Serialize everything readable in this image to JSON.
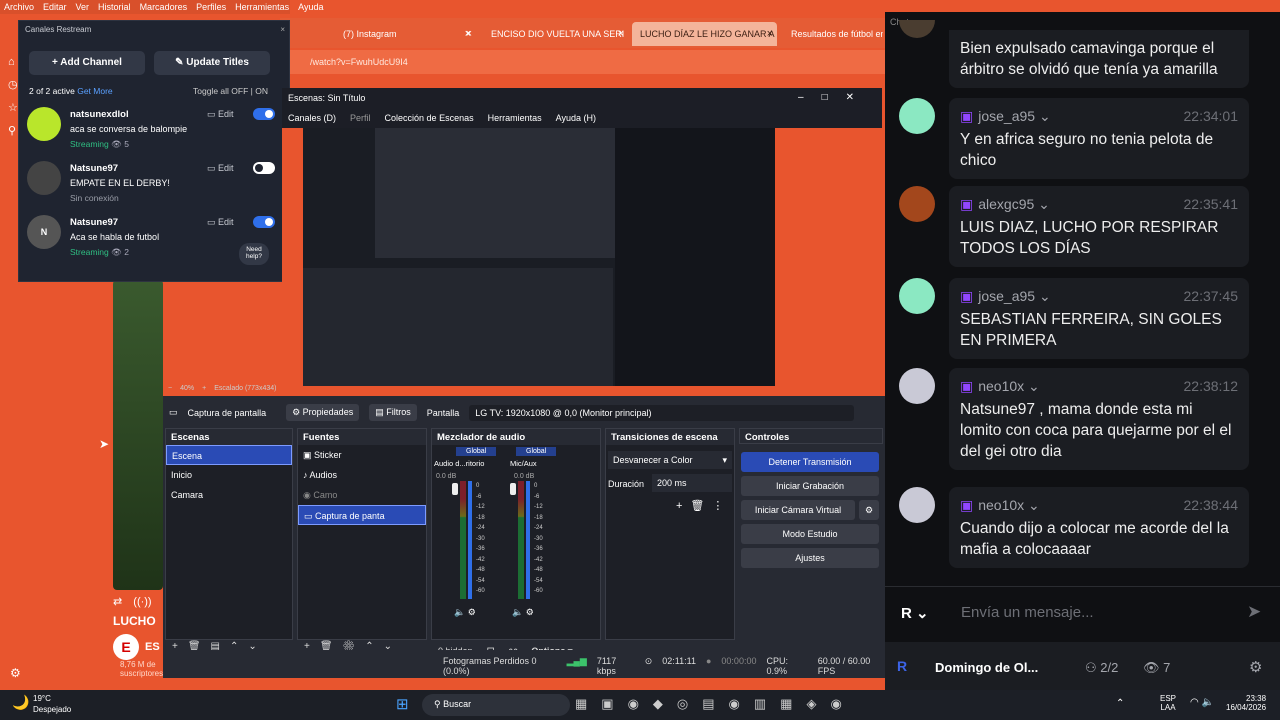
{
  "menubar": [
    "Archivo",
    "Editar",
    "Ver",
    "Historial",
    "Marcadores",
    "Perfiles",
    "Herramientas",
    "Ayuda"
  ],
  "tabs": [
    {
      "label": "(7) Instagram"
    },
    {
      "label": "ENCISO DIO VUELTA UNA SERI"
    },
    {
      "label": "LUCHO DÍAZ LE HIZO GANAR A"
    },
    {
      "label": "Resultados de fútbol en"
    }
  ],
  "url": "/watch?v=FwuhUdcU9I4",
  "restream": {
    "header": "Canales Restream",
    "add_channel": "Add Channel",
    "update_titles": "Update Titles",
    "active": "2 of 2 active",
    "get_more": "Get More",
    "toggle_all": "Toggle all",
    "off": "OFF",
    "on": "ON",
    "edit": "Edit",
    "need_help": "Need help?",
    "channels": [
      {
        "name": "natsunexdlol",
        "title": "aca se conversa de balompie",
        "status": "Streaming",
        "viewers": "5"
      },
      {
        "name": "Natsune97",
        "title": "EMPATE EN EL DERBY!",
        "status": "Sin conexión",
        "viewers": ""
      },
      {
        "name": "Natsune97",
        "title": "Aca se habla de futbol",
        "status": "Streaming",
        "viewers": "2"
      }
    ]
  },
  "obs": {
    "window_title": "Escenas: Sin Título",
    "menu": [
      "Canales (D)",
      "Perfil",
      "Colección de Escenas",
      "Herramientas",
      "Ayuda (H)"
    ],
    "zoom": "40%",
    "scaled": "Escalado (773x434)",
    "source_toolbar": {
      "name": "Captura de pantalla",
      "props": "Propiedades",
      "filters": "Filtros",
      "screen_label": "Pantalla",
      "screen_value": "LG TV: 1920x1080 @ 0,0 (Monitor principal)"
    },
    "scenes_title": "Escenas",
    "scenes": [
      "Escena",
      "Inicio",
      "Camara"
    ],
    "sources_title": "Fuentes",
    "sources": [
      "Sticker",
      "Audios",
      "Camo",
      "Captura de panta"
    ],
    "mixer_title": "Mezclador de audio",
    "mixer_global": "Global",
    "mixer_ch1": "Audio d...ritorio",
    "mixer_ch2": "Mic/Aux",
    "mixer_db": "0.0 dB",
    "mixer_scale": [
      "0",
      "-6",
      "-12",
      "-18",
      "-24",
      "-30",
      "-36",
      "-42",
      "-48",
      "-54",
      "-60"
    ],
    "hidden": "0 hidden",
    "options": "Options",
    "transitions_title": "Transiciones de escena",
    "transition": "Desvanecer a Color",
    "duration_label": "Duración",
    "duration": "200 ms",
    "controls_title": "Controles",
    "controls": [
      "Detener Transmisión",
      "Iniciar Grabación",
      "Iniciar Cámara Virtual",
      "Modo Estudio",
      "Ajustes"
    ],
    "status": {
      "dropped": "Fotogramas Perdidos 0 (0.0%)",
      "kbps": "7117 kbps",
      "stream_time": "02:11:11",
      "rec_time": "00:00:00",
      "cpu": "CPU: 0.9%",
      "fps": "60.00 / 60.00 FPS"
    }
  },
  "chat": {
    "title": "Chat",
    "top_msg": "Bien expulsado camavinga porque el árbitro se olvidó que tenía ya amarilla",
    "messages": [
      {
        "user": "jose_a95",
        "time": "22:34:01",
        "text": "Y en africa seguro no tenia pelota de chico"
      },
      {
        "user": "alexgc95",
        "time": "22:35:41",
        "text": "LUIS DIAZ, LUCHO POR RESPIRAR TODOS LOS DÍAS"
      },
      {
        "user": "jose_a95",
        "time": "22:37:45",
        "text": "SEBASTIAN FERREIRA, SIN GOLES EN PRIMERA"
      },
      {
        "user": "neo10x",
        "time": "22:38:12",
        "text": "Natsune97 , mama donde esta mi lomito con coca para quejarme por el el del gei otro dia"
      },
      {
        "user": "neo10x",
        "time": "22:38:44",
        "text": "Cuando dijo a colocar me acorde del la mafia a colocaaaar"
      }
    ],
    "placeholder": "Envía un mensaje...",
    "footer_name": "Domingo de Ol...",
    "count": "2/2",
    "viewers": "7"
  },
  "page": {
    "video_title": "LUCHO",
    "channel": "ES",
    "subs": "8,76 M de suscriptores"
  },
  "taskbar": {
    "temp": "19°C",
    "weather": "Despejado",
    "search": "Buscar",
    "lang1": "ESP",
    "lang2": "LAA",
    "time": "23:38",
    "date": "16/04/2026"
  }
}
